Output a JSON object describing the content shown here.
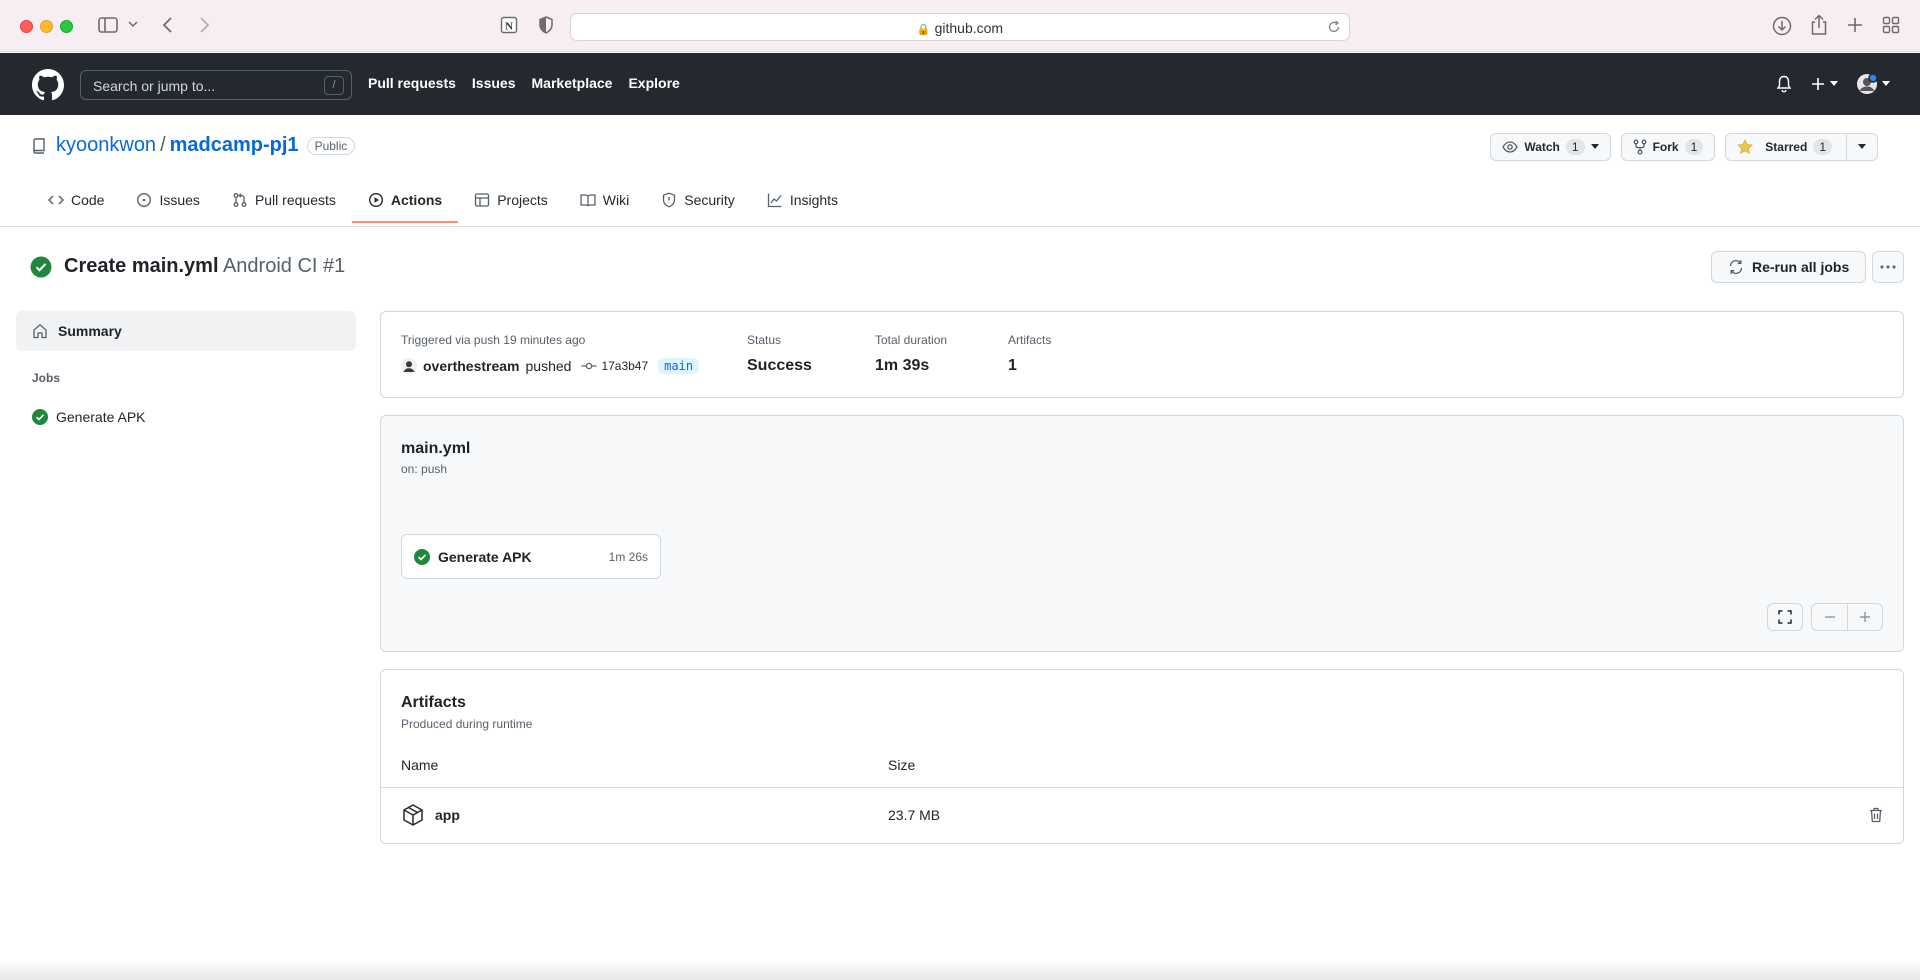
{
  "browser": {
    "url": "github.com"
  },
  "header": {
    "search_placeholder": "Search or jump to...",
    "search_shortcut": "/",
    "nav": [
      "Pull requests",
      "Issues",
      "Marketplace",
      "Explore"
    ]
  },
  "repo": {
    "owner": "kyoonkwon",
    "separator": "/",
    "name": "madcamp-pj1",
    "visibility": "Public",
    "watch_label": "Watch",
    "watch_count": "1",
    "fork_label": "Fork",
    "fork_count": "1",
    "star_label": "Starred",
    "star_count": "1",
    "tabs": [
      {
        "label": "Code",
        "icon": "code-icon"
      },
      {
        "label": "Issues",
        "icon": "issue-icon"
      },
      {
        "label": "Pull requests",
        "icon": "pull-request-icon"
      },
      {
        "label": "Actions",
        "icon": "play-icon",
        "active": true
      },
      {
        "label": "Projects",
        "icon": "table-icon"
      },
      {
        "label": "Wiki",
        "icon": "book-icon"
      },
      {
        "label": "Security",
        "icon": "shield-icon"
      },
      {
        "label": "Insights",
        "icon": "graph-icon"
      }
    ]
  },
  "run": {
    "title": "Create main.yml",
    "subtitle": "Android CI #1",
    "rerun_label": "Re-run all jobs"
  },
  "sidebar": {
    "summary_label": "Summary",
    "jobs_heading": "Jobs",
    "jobs": [
      {
        "label": "Generate APK"
      }
    ]
  },
  "info": {
    "trigger": "Triggered via push 19 minutes ago",
    "pusher": "overthestream",
    "pusher_action": "pushed",
    "commit": "17a3b47",
    "branch": "main",
    "status_label": "Status",
    "status_value": "Success",
    "duration_label": "Total duration",
    "duration_value": "1m 39s",
    "artifacts_label": "Artifacts",
    "artifacts_value": "1"
  },
  "workflow": {
    "file": "main.yml",
    "trigger": "on: push",
    "job_name": "Generate APK",
    "job_duration": "1m 26s"
  },
  "artifacts": {
    "title": "Artifacts",
    "subtitle": "Produced during runtime",
    "col_name": "Name",
    "col_size": "Size",
    "rows": [
      {
        "name": "app",
        "size": "23.7 MB"
      }
    ]
  },
  "colors": {
    "success": "#1f883d",
    "link": "#0969da",
    "header_bg": "#24292f",
    "active_tab_underline": "#fd8c73"
  }
}
